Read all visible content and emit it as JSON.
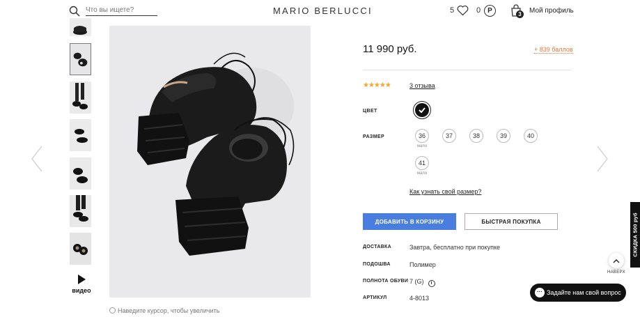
{
  "header": {
    "search_placeholder": "Что вы ищете?",
    "logo": "MARIO BERLUCCI",
    "favorites_count": "5",
    "points_count": "0",
    "points_symbol": "P",
    "cart_count": "3",
    "profile_label": "Мой профиль"
  },
  "gallery": {
    "video_label": "видео",
    "zoom_hint": "Наведите курсор, чтобы увеличить"
  },
  "product": {
    "price": "11 990 руб.",
    "bonus": "+ 839 баллов",
    "rating_stars": "★★★★★",
    "reviews": "3 отзыва",
    "color_label": "ЦВЕТ",
    "size_label": "РАЗМЕР",
    "sizes": [
      {
        "value": "36",
        "note": "мало"
      },
      {
        "value": "37",
        "note": ""
      },
      {
        "value": "38",
        "note": ""
      },
      {
        "value": "39",
        "note": ""
      },
      {
        "value": "40",
        "note": ""
      },
      {
        "value": "41",
        "note": "мало"
      }
    ],
    "size_guide": "Как узнать свой размер?",
    "add_to_cart": "ДОБАВИТЬ В КОРЗИНУ",
    "quick_buy": "БЫСТРАЯ ПОКУПКА",
    "specs": [
      {
        "label": "ДОСТАВКА",
        "value": "Завтра, бесплатно при покупке"
      },
      {
        "label": "ПОДОШВА",
        "value": "Полимер"
      },
      {
        "label": "ПОЛНОТА ОБУВИ",
        "value": "7 (G)"
      },
      {
        "label": "АРТИКУЛ",
        "value": "4-8013"
      }
    ]
  },
  "widgets": {
    "discount_tab": "СКИДКА 500 руб",
    "to_top": "НАВЕРХ",
    "chat": "Задайте нам свой вопрос"
  },
  "colors": {
    "accent_blue": "#4a7de0",
    "bonus_orange": "#e8763a",
    "star_gold": "#f5a623"
  }
}
